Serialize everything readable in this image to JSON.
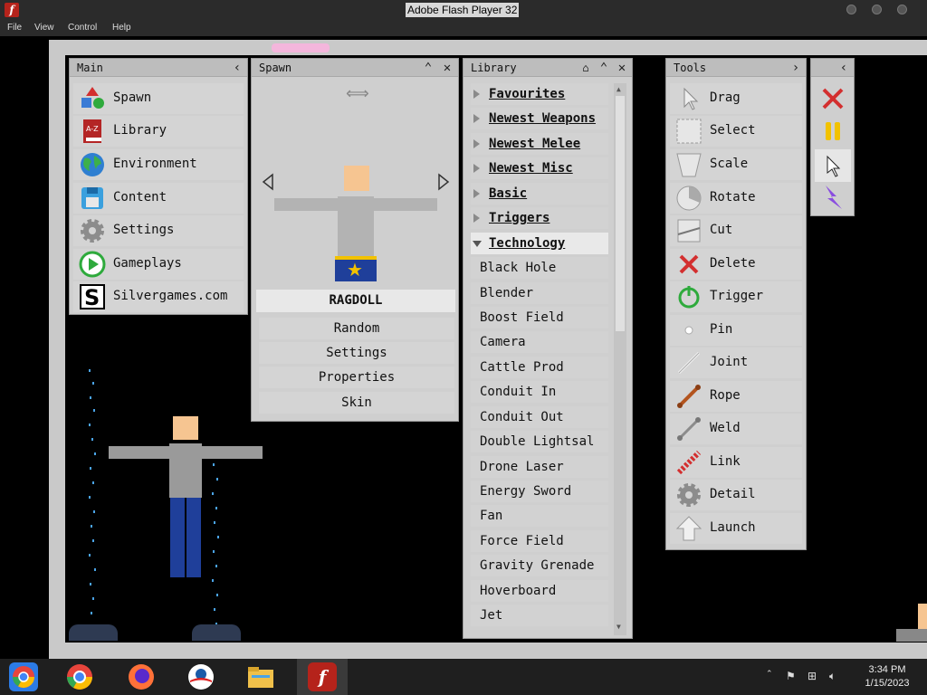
{
  "window": {
    "title": "Adobe Flash Player 32"
  },
  "menubar": [
    "File",
    "View",
    "Control",
    "Help"
  ],
  "main_panel": {
    "title": "Main",
    "items": [
      {
        "label": "Spawn",
        "icon": "shapes-icon"
      },
      {
        "label": "Library",
        "icon": "book-az-icon"
      },
      {
        "label": "Environment",
        "icon": "globe-icon"
      },
      {
        "label": "Content",
        "icon": "floppy-disk-icon"
      },
      {
        "label": "Settings",
        "icon": "gear-icon"
      },
      {
        "label": "Gameplays",
        "icon": "play-circle-icon"
      },
      {
        "label": "Silvergames.com",
        "icon": "silvergames-logo-icon"
      }
    ]
  },
  "spawn_panel": {
    "title": "Spawn",
    "selected": "RAGDOLL",
    "options": [
      "Random",
      "Settings",
      "Properties",
      "Skin"
    ]
  },
  "library_panel": {
    "title": "Library",
    "folders": [
      "Favourites",
      "Newest Weapons",
      "Newest Melee",
      "Newest Misc",
      "Basic",
      "Triggers",
      "Technology"
    ],
    "items": [
      "Black Hole",
      "Blender",
      "Boost Field",
      "Camera",
      "Cattle Prod",
      "Conduit In",
      "Conduit Out",
      "Double Lightsal",
      "Drone Laser",
      "Energy Sword",
      "Fan",
      "Force Field",
      "Gravity Grenade",
      "Hoverboard",
      "Jet"
    ]
  },
  "tools_panel": {
    "title": "Tools",
    "items": [
      {
        "label": "Drag",
        "icon": "cursor-icon"
      },
      {
        "label": "Select",
        "icon": "select-box-icon"
      },
      {
        "label": "Scale",
        "icon": "scale-icon"
      },
      {
        "label": "Rotate",
        "icon": "rotate-icon"
      },
      {
        "label": "Cut",
        "icon": "cut-icon"
      },
      {
        "label": "Delete",
        "icon": "delete-x-icon"
      },
      {
        "label": "Trigger",
        "icon": "trigger-icon"
      },
      {
        "label": "Pin",
        "icon": "pin-icon"
      },
      {
        "label": "Joint",
        "icon": "joint-icon"
      },
      {
        "label": "Rope",
        "icon": "rope-icon"
      },
      {
        "label": "Weld",
        "icon": "weld-icon"
      },
      {
        "label": "Link",
        "icon": "link-icon"
      },
      {
        "label": "Detail",
        "icon": "detail-gear-icon"
      },
      {
        "label": "Launch",
        "icon": "launch-arrow-icon"
      }
    ]
  },
  "taskbar": {
    "apps": [
      "chrome-icon",
      "firefox-icon",
      "obama-icon",
      "file-explorer-icon",
      "flash-player-icon"
    ],
    "time": "3:34 PM",
    "date": "1/15/2023"
  },
  "colors": {
    "panel": "#cfcfcf",
    "accent_blue": "#4aa3e6",
    "delete_red": "#d32f2f",
    "pause_yellow": "#f2c200"
  }
}
